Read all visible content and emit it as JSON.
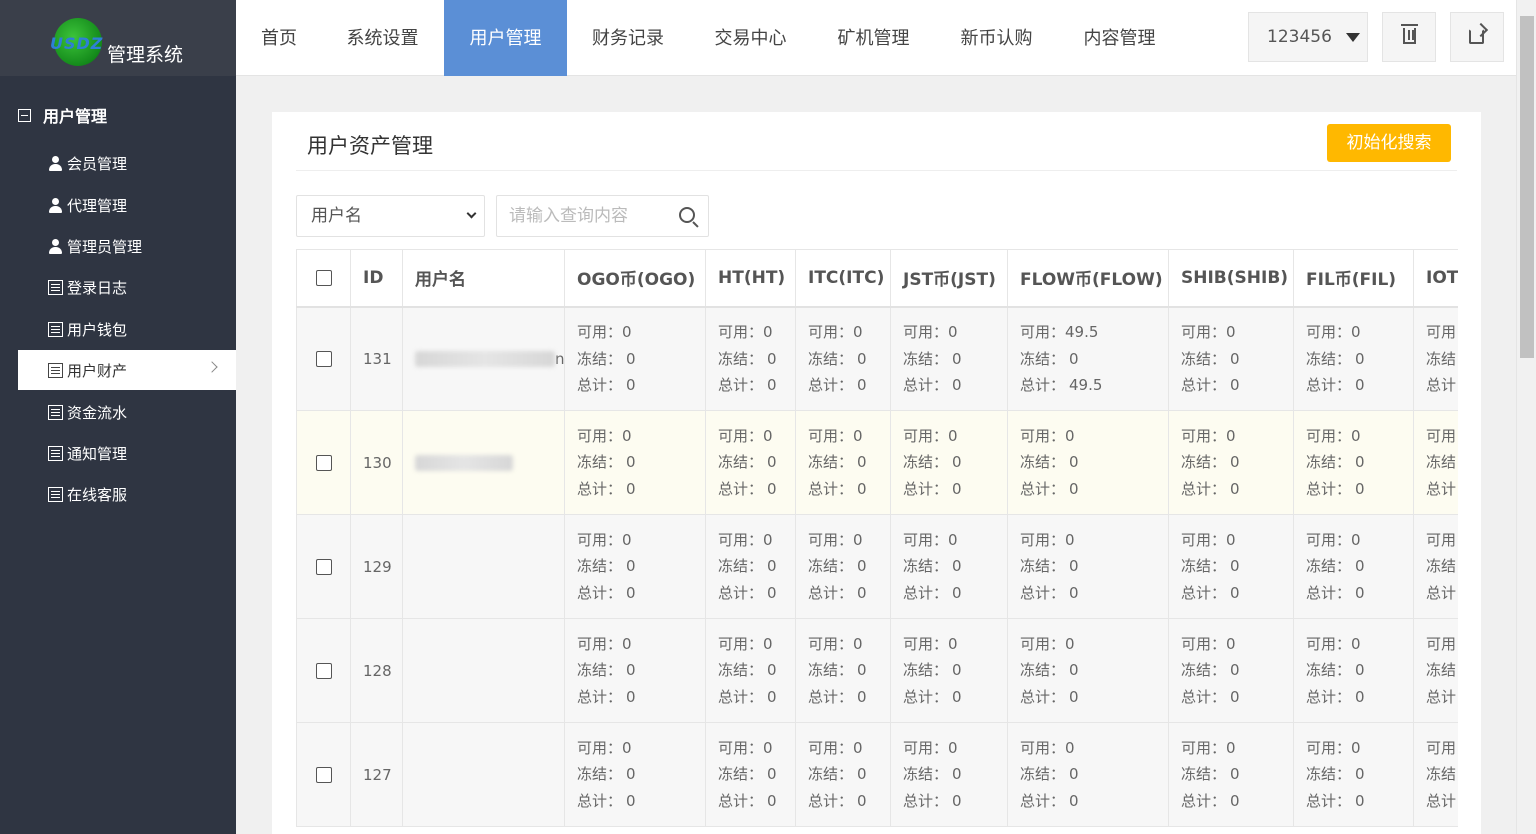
{
  "app": {
    "logo_text": "USDZ",
    "title": "管理系统"
  },
  "nav": {
    "tabs": [
      {
        "label": "首页"
      },
      {
        "label": "系统设置"
      },
      {
        "label": "用户管理",
        "active": true
      },
      {
        "label": "财务记录"
      },
      {
        "label": "交易中心"
      },
      {
        "label": "矿机管理"
      },
      {
        "label": "新币认购"
      },
      {
        "label": "内容管理"
      }
    ],
    "user": "123456"
  },
  "sidebar": {
    "group": "用户管理",
    "items": [
      {
        "label": "会员管理",
        "icon": "person-icon"
      },
      {
        "label": "代理管理",
        "icon": "person-icon"
      },
      {
        "label": "管理员管理",
        "icon": "person-icon"
      },
      {
        "label": "登录日志",
        "icon": "list-icon"
      },
      {
        "label": "用户钱包",
        "icon": "list-icon"
      },
      {
        "label": "用户财产",
        "icon": "list-icon",
        "active": true
      },
      {
        "label": "资金流水",
        "icon": "list-icon"
      },
      {
        "label": "通知管理",
        "icon": "list-icon"
      },
      {
        "label": "在线客服",
        "icon": "list-icon"
      }
    ]
  },
  "panel": {
    "title": "用户资产管理",
    "init_button": "初始化搜索",
    "filter_select": "用户名",
    "search_placeholder": "请输入查询内容"
  },
  "table": {
    "headers": [
      "ID",
      "用户名",
      "OGO币(OGO)",
      "HT(HT)",
      "ITC(ITC)",
      "JST币(JST)",
      "FLOW币(FLOW)",
      "SHIB(SHIB)",
      "FIL币(FIL)",
      "IOTX"
    ],
    "labels": {
      "available": "可用：",
      "frozen": "冻结：",
      "total": "总计："
    },
    "rows": [
      {
        "id": "131",
        "username_suffix": "n",
        "blurred": true,
        "highlight": false,
        "coins": [
          [
            "0",
            "0",
            "0"
          ],
          [
            "0",
            "0",
            "0"
          ],
          [
            "0",
            "0",
            "0"
          ],
          [
            "0",
            "0",
            "0"
          ],
          [
            "49.5",
            "0",
            "49.5"
          ],
          [
            "0",
            "0",
            "0"
          ],
          [
            "0",
            "0",
            "0"
          ],
          [
            "",
            "",
            " "
          ]
        ]
      },
      {
        "id": "130",
        "username_suffix": "",
        "blurred": true,
        "highlight": true,
        "coins": [
          [
            "0",
            "0",
            "0"
          ],
          [
            "0",
            "0",
            "0"
          ],
          [
            "0",
            "0",
            "0"
          ],
          [
            "0",
            "0",
            "0"
          ],
          [
            "0",
            "0",
            "0"
          ],
          [
            "0",
            "0",
            "0"
          ],
          [
            "0",
            "0",
            "0"
          ],
          [
            "",
            "",
            " "
          ]
        ]
      },
      {
        "id": "129",
        "username_suffix": "",
        "blurred": false,
        "highlight": false,
        "coins": [
          [
            "0",
            "0",
            "0"
          ],
          [
            "0",
            "0",
            "0"
          ],
          [
            "0",
            "0",
            "0"
          ],
          [
            "0",
            "0",
            "0"
          ],
          [
            "0",
            "0",
            "0"
          ],
          [
            "0",
            "0",
            "0"
          ],
          [
            "0",
            "0",
            "0"
          ],
          [
            "",
            "",
            " "
          ]
        ]
      },
      {
        "id": "128",
        "username_suffix": "",
        "blurred": false,
        "highlight": false,
        "coins": [
          [
            "0",
            "0",
            "0"
          ],
          [
            "0",
            "0",
            "0"
          ],
          [
            "0",
            "0",
            "0"
          ],
          [
            "0",
            "0",
            "0"
          ],
          [
            "0",
            "0",
            "0"
          ],
          [
            "0",
            "0",
            "0"
          ],
          [
            "0",
            "0",
            "0"
          ],
          [
            "",
            "",
            " "
          ]
        ]
      },
      {
        "id": "127",
        "username_suffix": "",
        "blurred": false,
        "highlight": false,
        "coins": [
          [
            "0",
            "0",
            "0"
          ],
          [
            "0",
            "0",
            "0"
          ],
          [
            "0",
            "0",
            "0"
          ],
          [
            "0",
            "0",
            "0"
          ],
          [
            "0",
            "0",
            "0"
          ],
          [
            "0",
            "0",
            "0"
          ],
          [
            "0",
            "0",
            "0"
          ],
          [
            "",
            "",
            " "
          ]
        ]
      }
    ]
  }
}
